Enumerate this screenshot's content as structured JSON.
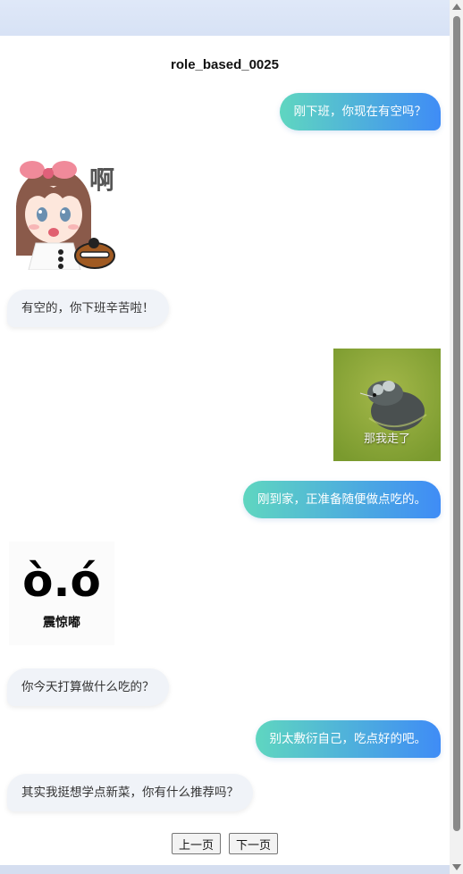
{
  "title": "role_based_0025",
  "messages": [
    {
      "side": "out",
      "text": "刚下班，你现在有空吗？"
    },
    {
      "side": "in",
      "sticker": "anime-girl-shocked",
      "caption": "啊"
    },
    {
      "side": "in",
      "text": "有空的，你下班辛苦啦！"
    },
    {
      "side": "out",
      "sticker": "mouse-in-water",
      "caption": "那我走了"
    },
    {
      "side": "out",
      "text": "刚到家，正准备随便做点吃的。"
    },
    {
      "side": "in",
      "sticker": "shocked-face-text",
      "caption": "ò.ó",
      "subcaption": "震惊嘟"
    },
    {
      "side": "in",
      "text": "你今天打算做什么吃的？"
    },
    {
      "side": "out",
      "text": "别太敷衍自己，吃点好的吧。"
    },
    {
      "side": "in",
      "text": "其实我挺想学点新菜，你有什么推荐吗？"
    }
  ],
  "pager": {
    "prev": "上一页",
    "next": "下一页"
  },
  "colors": {
    "out_start": "#5fd6c0",
    "out_end": "#3f8cf6",
    "in_bg": "#f0f3f8"
  }
}
